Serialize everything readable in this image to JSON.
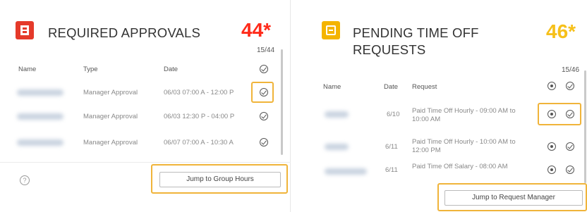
{
  "left": {
    "title": "REQUIRED APPROVALS",
    "count": "44*",
    "pager": "15/44",
    "columns": [
      "Name",
      "Type",
      "Date"
    ],
    "rows": [
      {
        "type": "Manager Approval",
        "date": "06/03 07:00 A - 12:00 P"
      },
      {
        "type": "Manager Approval",
        "date": "06/03 12:30 P - 04:00 P"
      },
      {
        "type": "Manager Approval",
        "date": "06/07 07:00 A - 10:30 A"
      }
    ],
    "help_glyph": "?",
    "button": "Jump to Group Hours"
  },
  "right": {
    "title_line1": "PENDING TIME OFF",
    "title_line2": "REQUESTS",
    "count": "46*",
    "pager": "15/46",
    "columns": [
      "Name",
      "Date",
      "Request"
    ],
    "rows": [
      {
        "date": "6/10",
        "request": "Paid Time Off Hourly - 09:00 AM to 10:00 AM"
      },
      {
        "date": "6/11",
        "request": "Paid Time Off Hourly - 10:00 AM to 12:00 PM"
      },
      {
        "date": "6/11",
        "request": "Paid Time Off Salary - 08:00 AM"
      }
    ],
    "button": "Jump to Request Manager"
  },
  "colors": {
    "red_accent": "#ff2a1a",
    "yellow_accent": "#f6c01a",
    "highlight": "#f0b43a"
  }
}
